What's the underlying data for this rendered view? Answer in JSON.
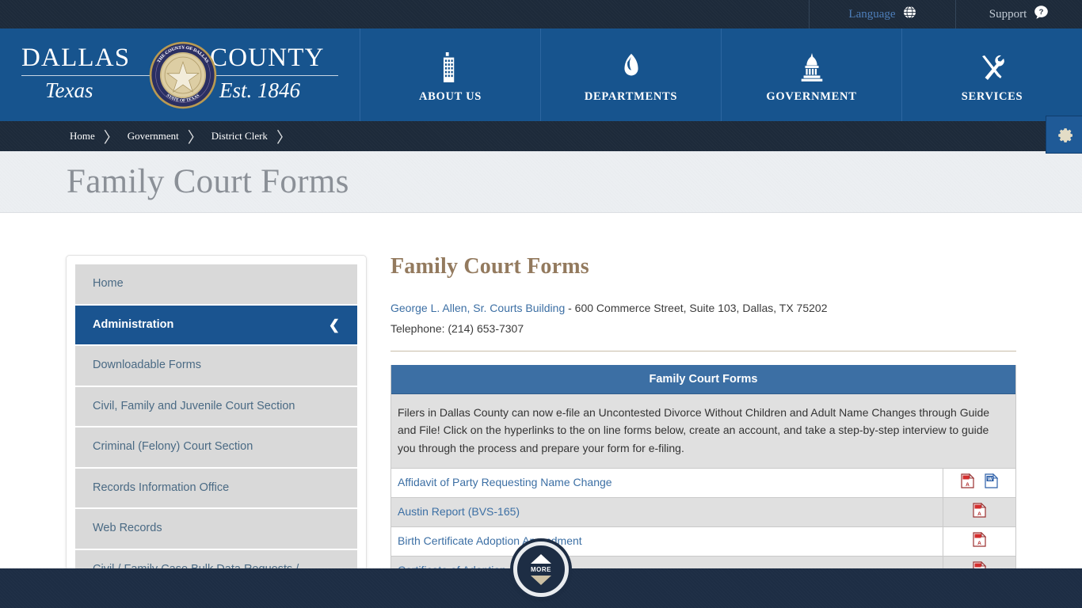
{
  "topbar": {
    "language_label": "Language",
    "language_icon": "globe-icon",
    "support_label": "Support",
    "support_icon": "question-help-icon"
  },
  "brand": {
    "word_left": "DALLAS",
    "word_right": "COUNTY",
    "sub_left": "Texas",
    "sub_right": "Est. 1846",
    "seal_top_text": "THE COUNTY OF DALLAS",
    "seal_bottom_text": "STATE OF TEXAS"
  },
  "mainnav": {
    "items": [
      {
        "label": "ABOUT US",
        "icon": "building-icon"
      },
      {
        "label": "DEPARTMENTS",
        "icon": "departments-circle-icon"
      },
      {
        "label": "GOVERNMENT",
        "icon": "capitol-dome-icon"
      },
      {
        "label": "SERVICES",
        "icon": "tools-wrench-screwdriver-icon"
      }
    ]
  },
  "breadcrumb": {
    "items": [
      "Home",
      "Government",
      "District Clerk"
    ],
    "separator": "〉"
  },
  "page": {
    "title": "Family Court Forms"
  },
  "sidebar": {
    "items": [
      {
        "label": "Home",
        "active": false
      },
      {
        "label": "Administration",
        "active": true
      },
      {
        "label": "Downloadable Forms",
        "active": false
      },
      {
        "label": "Civil, Family and Juvenile Court Section",
        "active": false
      },
      {
        "label": "Criminal (Felony) Court Section",
        "active": false
      },
      {
        "label": "Records Information Office",
        "active": false
      },
      {
        "label": "Web Records",
        "active": false
      },
      {
        "label": "Civil / Family Case Bulk Data Requests / Subscriptions",
        "active": false
      }
    ]
  },
  "main": {
    "heading": "Family Court Forms",
    "address_link": "George L. Allen, Sr. Courts Building",
    "address_rest": " - 600 Commerce Street, Suite 103, Dallas, TX 75202",
    "telephone": "Telephone: (214) 653-7307",
    "table": {
      "header": "Family Court Forms",
      "intro": "Filers in Dallas County can now e-file an Uncontested Divorce Without Children and Adult Name Changes through Guide and File! Click on the hyperlinks to the on line forms below, create an account, and take a step-by-step interview to guide you through the process and prepare your form for e-filing.",
      "rows": [
        {
          "name": "Affidavit of Party Requesting Name Change",
          "formats": [
            "pdf-icon",
            "word-icon"
          ]
        },
        {
          "name": "Austin Report (BVS-165)",
          "formats": [
            "pdf-icon"
          ]
        },
        {
          "name": "Birth Certificate Adoption Amendment",
          "formats": [
            "pdf-icon"
          ]
        },
        {
          "name": "Certificate of Adoption",
          "formats": [
            "pdf-icon"
          ]
        }
      ]
    }
  },
  "floating": {
    "more_label": "MORE",
    "gear_icon": "gear-settings-icon"
  },
  "colors": {
    "header_blue": "#17548e",
    "dark_navy": "#1d2a3a",
    "footer_navy": "#1d2d44",
    "table_header_blue": "#3c6fa4",
    "sidebar_active_blue": "#1a5490",
    "link_blue": "#3c6fa4",
    "heading_tan": "#937a5e",
    "page_title_gray": "#8b9097",
    "gear_tan": "#e3dcc6"
  }
}
